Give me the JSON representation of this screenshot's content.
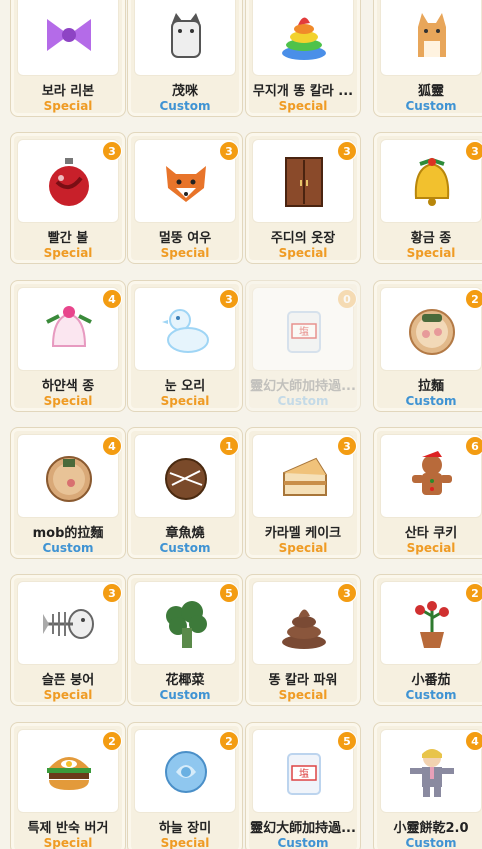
{
  "items": [
    {
      "name": "보라 리본",
      "type": "Special",
      "count": "",
      "icon": "purple-ribbon-icon",
      "color": "#b46be8"
    },
    {
      "name": "茂咪",
      "type": "Custom",
      "count": "",
      "icon": "cat-icon",
      "color": "#9a9a9a"
    },
    {
      "name": "무지개 똥 칼라 ...",
      "type": "Special",
      "count": "",
      "icon": "rainbow-poop-icon",
      "color": "#e94b3c"
    },
    {
      "name": "狐靈",
      "type": "Custom",
      "count": "",
      "icon": "fox-spirit-icon",
      "color": "#e8a65a"
    },
    {
      "name": "빨간 볼",
      "type": "Special",
      "count": "3",
      "icon": "red-ornament-icon",
      "color": "#c8202a"
    },
    {
      "name": "멀뚱 여우",
      "type": "Special",
      "count": "3",
      "icon": "fox-icon",
      "color": "#e8742a"
    },
    {
      "name": "주디의 옷장",
      "type": "Special",
      "count": "3",
      "icon": "wardrobe-icon",
      "color": "#8a4a2a"
    },
    {
      "name": "황금 종",
      "type": "Special",
      "count": "3",
      "icon": "golden-bell-icon",
      "color": "#f2c12e"
    },
    {
      "name": "하얀색 종",
      "type": "Special",
      "count": "4",
      "icon": "white-bell-icon",
      "color": "#f7b9d6"
    },
    {
      "name": "눈 오리",
      "type": "Special",
      "count": "3",
      "icon": "snow-duck-icon",
      "color": "#9fd5f5"
    },
    {
      "name": "靈幻大師加持過...",
      "type": "Custom",
      "count": "0",
      "icon": "salt-bag-icon",
      "color": "#bcd4ee",
      "disabled": true
    },
    {
      "name": "拉麵",
      "type": "Custom",
      "count": "2",
      "icon": "ramen-icon",
      "color": "#e2b98a"
    },
    {
      "name": "mob的拉麵",
      "type": "Custom",
      "count": "4",
      "icon": "ramen-bowl-icon",
      "color": "#d9a978"
    },
    {
      "name": "章魚燒",
      "type": "Custom",
      "count": "1",
      "icon": "takoyaki-icon",
      "color": "#7a4a2a"
    },
    {
      "name": "카라멜 케이크",
      "type": "Special",
      "count": "3",
      "icon": "caramel-cake-icon",
      "color": "#f0c27a"
    },
    {
      "name": "산타 쿠키",
      "type": "Special",
      "count": "6",
      "icon": "gingerbread-icon",
      "color": "#b86a3a"
    },
    {
      "name": "슬픈 붕어",
      "type": "Special",
      "count": "3",
      "icon": "fish-bone-icon",
      "color": "#bdbdbd"
    },
    {
      "name": "花椰菜",
      "type": "Custom",
      "count": "5",
      "icon": "broccoli-icon",
      "color": "#3d7a3a"
    },
    {
      "name": "똥 칼라 파워",
      "type": "Special",
      "count": "3",
      "icon": "poop-icon",
      "color": "#7a4a34"
    },
    {
      "name": "小番茄",
      "type": "Custom",
      "count": "2",
      "icon": "tomato-plant-icon",
      "color": "#d03030"
    },
    {
      "name": "특제 반숙 버거",
      "type": "Special",
      "count": "2",
      "icon": "burger-icon",
      "color": "#e39a3a"
    },
    {
      "name": "하늘 장미",
      "type": "Special",
      "count": "2",
      "icon": "sky-rose-icon",
      "color": "#8fc7ef"
    },
    {
      "name": "靈幻大師加持過...",
      "type": "Custom",
      "count": "5",
      "icon": "salt-bag-icon",
      "color": "#bcd4ee"
    },
    {
      "name": "小靈餅乾2.0",
      "type": "Custom",
      "count": "4",
      "icon": "man-doll-icon",
      "color": "#8a8aa0"
    }
  ]
}
